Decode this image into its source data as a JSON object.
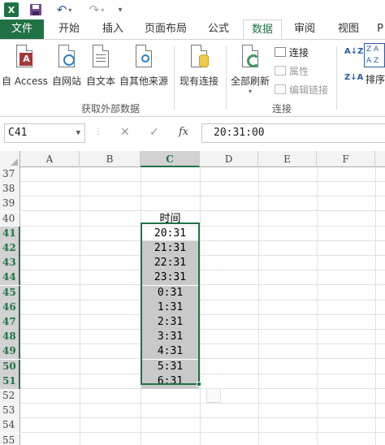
{
  "quick_access": {
    "app_icon": "X",
    "save_icon": "save-icon",
    "undo_icon": "undo-icon",
    "redo_icon": "redo-icon",
    "more_icon": "customize-icon"
  },
  "tabs": [
    "文件",
    "开始",
    "插入",
    "页面布局",
    "公式",
    "数据",
    "审阅",
    "视图",
    "P"
  ],
  "active_tab": "数据",
  "ribbon": {
    "get_external": {
      "buttons": [
        "自 Access",
        "自网站",
        "自文本",
        "自其他来源",
        "现有连接"
      ],
      "group_label": "获取外部数据"
    },
    "connections": {
      "refresh_all": "全部刷新",
      "connections": "连接",
      "properties": "属性",
      "edit_links": "编辑链接",
      "group_label": "连接"
    },
    "sort": {
      "sort_az": "A↓Z",
      "sort_za": "Z↓A",
      "sort": "排序"
    }
  },
  "formula_bar": {
    "name_box": "C41",
    "cancel_icon": "✕",
    "enter_icon": "✓",
    "fx": "fx",
    "formula": "20:31:00"
  },
  "sheet": {
    "columns": [
      "A",
      "B",
      "C",
      "D",
      "E",
      "F"
    ],
    "selected_column": "C",
    "rows": [
      {
        "num": "37",
        "c": ""
      },
      {
        "num": "38",
        "c": ""
      },
      {
        "num": "39",
        "c": ""
      },
      {
        "num": "40",
        "c": "时间"
      },
      {
        "num": "41",
        "c": "20:31"
      },
      {
        "num": "42",
        "c": "21:31"
      },
      {
        "num": "43",
        "c": "22:31"
      },
      {
        "num": "44",
        "c": "23:31"
      },
      {
        "num": "45",
        "c": "0:31"
      },
      {
        "num": "46",
        "c": "1:31"
      },
      {
        "num": "47",
        "c": "2:31"
      },
      {
        "num": "48",
        "c": "3:31"
      },
      {
        "num": "49",
        "c": "4:31"
      },
      {
        "num": "50",
        "c": "5:31"
      },
      {
        "num": "51",
        "c": "6:31"
      },
      {
        "num": "52",
        "c": ""
      },
      {
        "num": "53",
        "c": ""
      },
      {
        "num": "54",
        "c": ""
      },
      {
        "num": "55",
        "c": ""
      }
    ]
  },
  "colors": {
    "accent": "#217346",
    "selection_fill": "#c9c9c9"
  }
}
